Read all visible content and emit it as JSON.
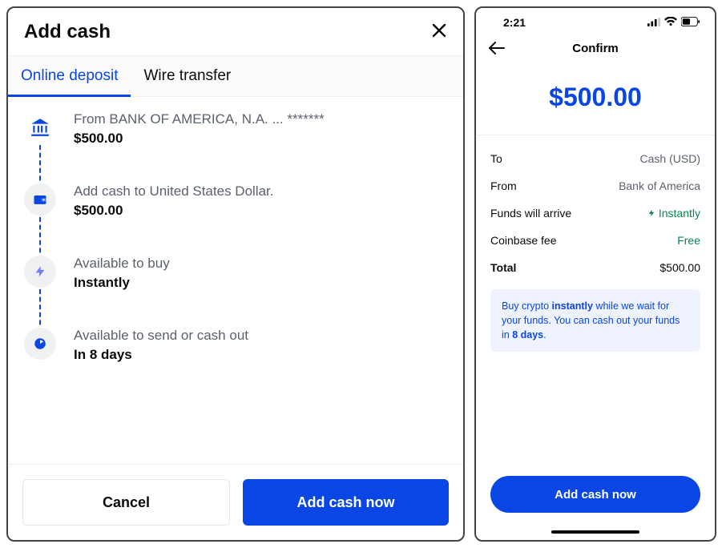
{
  "left": {
    "title": "Add cash",
    "tabs": {
      "online": "Online deposit",
      "wire": "Wire transfer"
    },
    "steps": [
      {
        "label": "From BANK OF AMERICA, N.A. ... *******",
        "value": "$500.00"
      },
      {
        "label": "Add cash to United States Dollar.",
        "value": "$500.00"
      },
      {
        "label": "Available to buy",
        "value": "Instantly"
      },
      {
        "label": "Available to send or cash out",
        "value": "In 8 days"
      }
    ],
    "buttons": {
      "cancel": "Cancel",
      "confirm": "Add cash now"
    }
  },
  "right": {
    "status_time": "2:21",
    "nav_title": "Confirm",
    "amount": "$500.00",
    "rows": {
      "to": {
        "label": "To",
        "value": "Cash (USD)"
      },
      "from": {
        "label": "From",
        "value": "Bank of America"
      },
      "arrive": {
        "label": "Funds will arrive",
        "value": "Instantly"
      },
      "fee": {
        "label": "Coinbase fee",
        "value": "Free"
      },
      "total": {
        "label": "Total",
        "value": "$500.00"
      }
    },
    "notice": {
      "prefix": "Buy crypto ",
      "bold1": "instantly",
      "mid": " while we wait for your funds. You can cash out your funds in ",
      "bold2": "8 days",
      "suffix": "."
    },
    "button": "Add cash now"
  }
}
